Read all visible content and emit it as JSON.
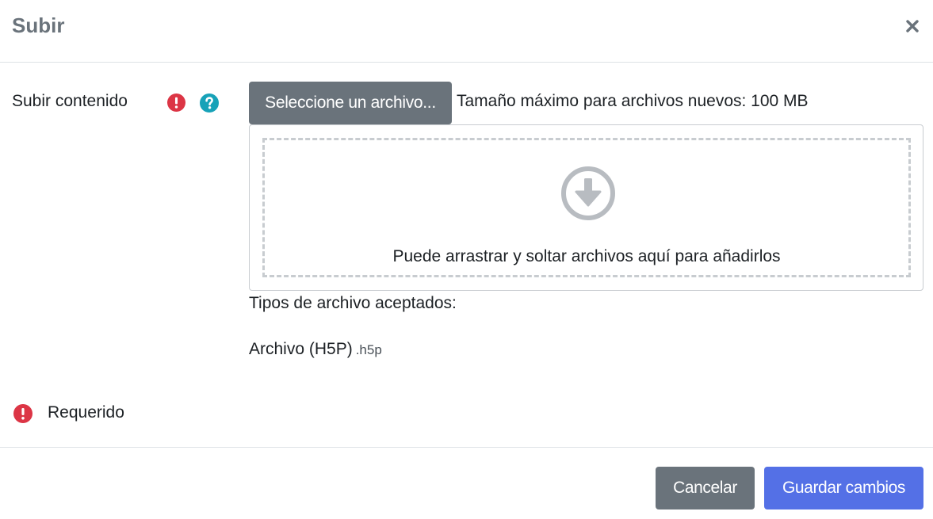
{
  "modal": {
    "title": "Subir",
    "close_icon": "close-icon"
  },
  "field": {
    "label": "Subir contenido",
    "required_icon": "exclamation-circle-icon",
    "help_icon": "question-circle-icon",
    "pick_button_label": "Seleccione un archivo...",
    "max_size_text": "Tamaño máximo para archivos nuevos: 100 MB"
  },
  "dropzone": {
    "icon": "arrow-circle-down-icon",
    "text": "Puede arrastrar y soltar archivos aquí para añadirlos"
  },
  "accepted": {
    "label": "Tipos de archivo aceptados:",
    "types": [
      {
        "name": "Archivo (H5P)",
        "extension": ".h5p"
      }
    ]
  },
  "legend": {
    "icon": "exclamation-circle-icon",
    "label": "Requerido"
  },
  "footer": {
    "cancel_label": "Cancelar",
    "save_label": "Guardar cambios"
  },
  "colors": {
    "required_red": "#dc3545",
    "help_teal": "#17a2b8",
    "secondary_gray": "#6a737b",
    "primary_blue": "#5470e6",
    "drop_icon_gray": "#b8bcc1"
  }
}
